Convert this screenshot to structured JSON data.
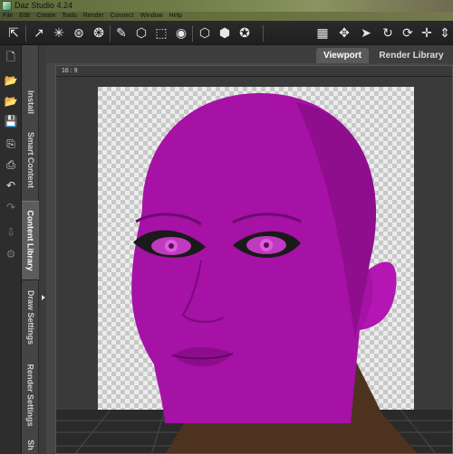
{
  "window": {
    "title": "Daz Studio 4.24"
  },
  "menu": [
    "File",
    "Edit",
    "Create",
    "Tools",
    "Render",
    "Connect",
    "Window",
    "Help"
  ],
  "toolbar": {
    "left_tools": [
      "node-selection-icon",
      "translate-icon",
      "rotate-icon",
      "scale-icon",
      "universal-icon",
      "joint-editor-icon",
      "geometry-editor-icon",
      "surface-selection-icon",
      "region-navigator-icon",
      "spot-render-icon",
      "morph-icon",
      "primitive-icon"
    ],
    "right_tools": [
      "align-icon",
      "center-icon",
      "pointer-icon",
      "camera-orbit-icon",
      "camera-rotate-icon",
      "camera-pan-icon",
      "camera-dolly-icon"
    ]
  },
  "left_actions": [
    "new-scene-icon",
    "open-icon",
    "merge-icon",
    "save-icon",
    "import-icon",
    "export-icon",
    "undo-icon",
    "redo-icon",
    "render-icon",
    "render-settings-icon"
  ],
  "side_tabs": [
    {
      "label": "Install",
      "active": false
    },
    {
      "label": "Smart Content",
      "active": false
    },
    {
      "label": "Content Library",
      "active": true
    },
    {
      "label": "Draw Settings",
      "active": false
    },
    {
      "label": "Render Settings",
      "active": false
    },
    {
      "label": "Sh",
      "active": false
    }
  ],
  "pane_tabs": [
    {
      "label": "Viewport",
      "active": true
    },
    {
      "label": "Render Library",
      "active": false
    }
  ],
  "viewport": {
    "aspect_label": "16 : 9"
  },
  "colors": {
    "figure_skin": "#a611a6",
    "neck_skin": "#5a3a22",
    "accent": "#5a5a5a"
  }
}
